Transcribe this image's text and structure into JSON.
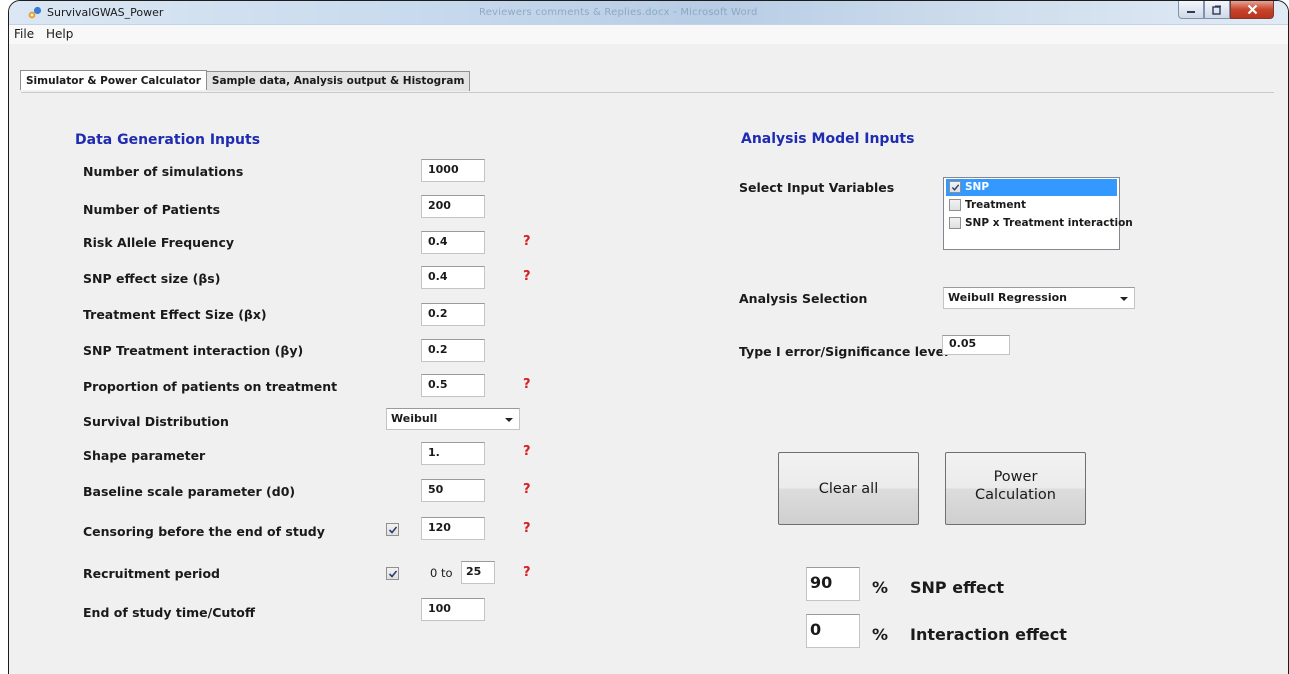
{
  "window": {
    "title": "SurvivalGWAS_Power",
    "background_title": "Reviewers comments & Replies.docx - Microsoft Word",
    "icons": [
      "app-icon",
      "minimize-icon",
      "restore-icon",
      "close-icon"
    ]
  },
  "menu": {
    "file": "File",
    "help": "Help"
  },
  "tabs": [
    {
      "label": "Simulator & Power Calculator",
      "active": true
    },
    {
      "label": "Sample data, Analysis output & Histogram",
      "active": false
    }
  ],
  "data_gen": {
    "title": "Data Generation Inputs",
    "num_sims": {
      "label": "Number of simulations",
      "value": "1000"
    },
    "num_patients": {
      "label": "Number of Patients",
      "value": "200"
    },
    "raf": {
      "label": "Risk Allele Frequency",
      "value": "0.4",
      "help": "?"
    },
    "snp_effect": {
      "label": "SNP effect size (βs)",
      "value": "0.4",
      "help": "?"
    },
    "treat_effect": {
      "label": "Treatment Effect Size (βx)",
      "value": "0.2"
    },
    "interaction": {
      "label": "SNP Treatment interaction (βy)",
      "value": "0.2"
    },
    "prop_treat": {
      "label": "Proportion of patients on treatment",
      "value": "0.5",
      "help": "?"
    },
    "surv_dist": {
      "label": "Survival Distribution",
      "value": "Weibull"
    },
    "shape": {
      "label": "Shape parameter",
      "value": "1.",
      "help": "?"
    },
    "baseline": {
      "label": "Baseline scale parameter (d0)",
      "value": "50",
      "help": "?"
    },
    "censoring": {
      "label": "Censoring before the end of study",
      "checked": true,
      "value": "120",
      "help": "?"
    },
    "recruitment": {
      "label": "Recruitment period",
      "checked": true,
      "from": "0 to",
      "value": "25",
      "help": "?"
    },
    "end_study": {
      "label": "End of study time/Cutoff",
      "value": "100"
    }
  },
  "analysis": {
    "title": "Analysis Model Inputs",
    "select_label": "Select Input Variables",
    "variables": [
      {
        "label": "SNP",
        "checked": true,
        "selected": true
      },
      {
        "label": "Treatment",
        "checked": false,
        "selected": false
      },
      {
        "label": "SNP x Treatment interaction",
        "checked": false,
        "selected": false
      }
    ],
    "selection_label": "Analysis Selection",
    "selection_value": "Weibull Regression",
    "alpha_label": "Type I error/Significance level",
    "alpha_value": "0.05"
  },
  "buttons": {
    "clear": "Clear all",
    "power_line1": "Power",
    "power_line2": "Calculation"
  },
  "results": {
    "snp_value": "90",
    "snp_pct": "%",
    "snp_label": "SNP effect",
    "int_value": "0",
    "int_pct": "%",
    "int_label": "Interaction effect"
  }
}
